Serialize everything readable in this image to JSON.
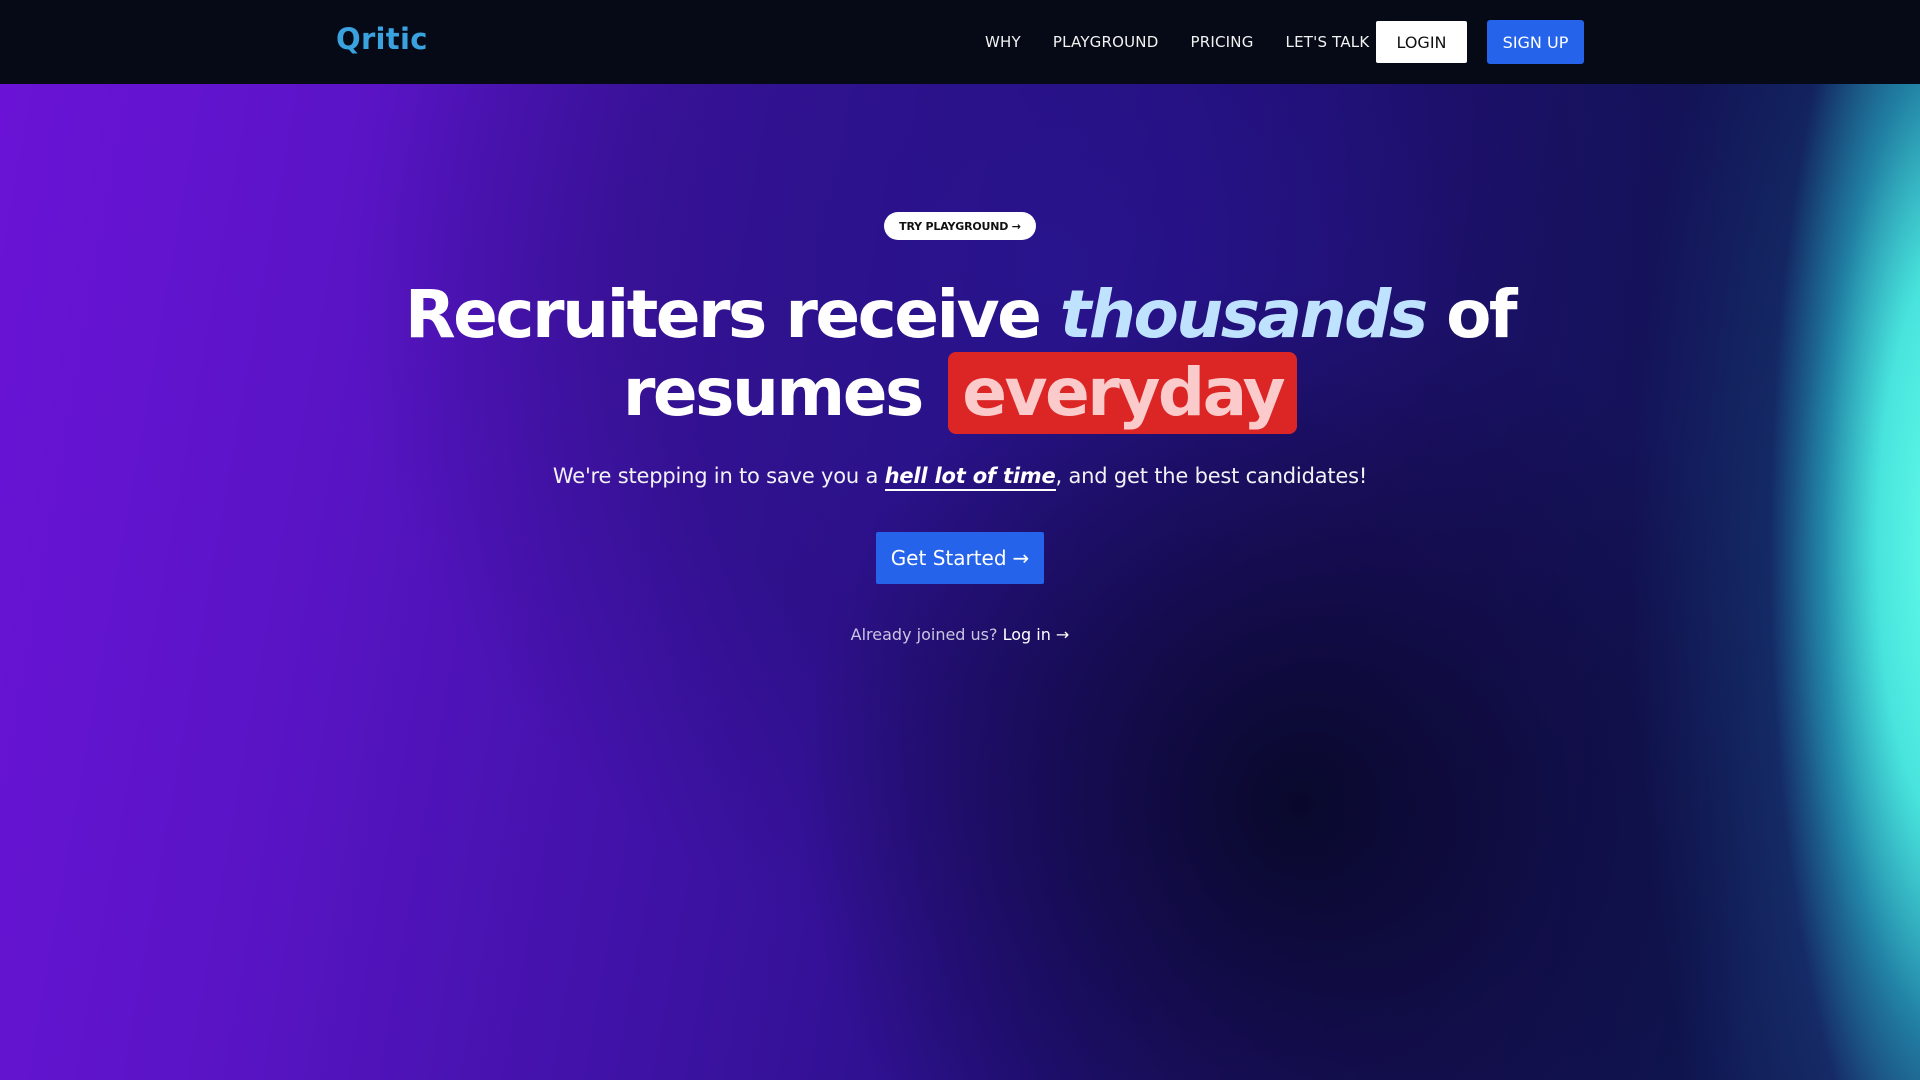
{
  "brand": {
    "name": "Qritic"
  },
  "nav": {
    "links": [
      "WHY",
      "PLAYGROUND",
      "PRICING",
      "LET'S TALK"
    ],
    "login_label": "LOGIN",
    "signup_label": "SIGN UP"
  },
  "hero": {
    "pill_label": "TRY PLAYGROUND →",
    "headline": {
      "part1": "Recruiters receive ",
      "emphasis": "thousands",
      "part2": " of",
      "part3": "resumes ",
      "badge": "everyday"
    },
    "subtext": {
      "before": "We're stepping in to save you a ",
      "emphasis": "hell lot of time",
      "after": ", and get the best candidates!"
    },
    "cta_label": "Get Started",
    "cta_arrow": "→",
    "already": {
      "text": "Already joined us? ",
      "link": "Log in →"
    }
  },
  "colors": {
    "brand": "#3aa2df",
    "primary_button": "#2563eb",
    "badge_bg": "#dc2626",
    "emphasis_text": "#bfe2ff"
  }
}
